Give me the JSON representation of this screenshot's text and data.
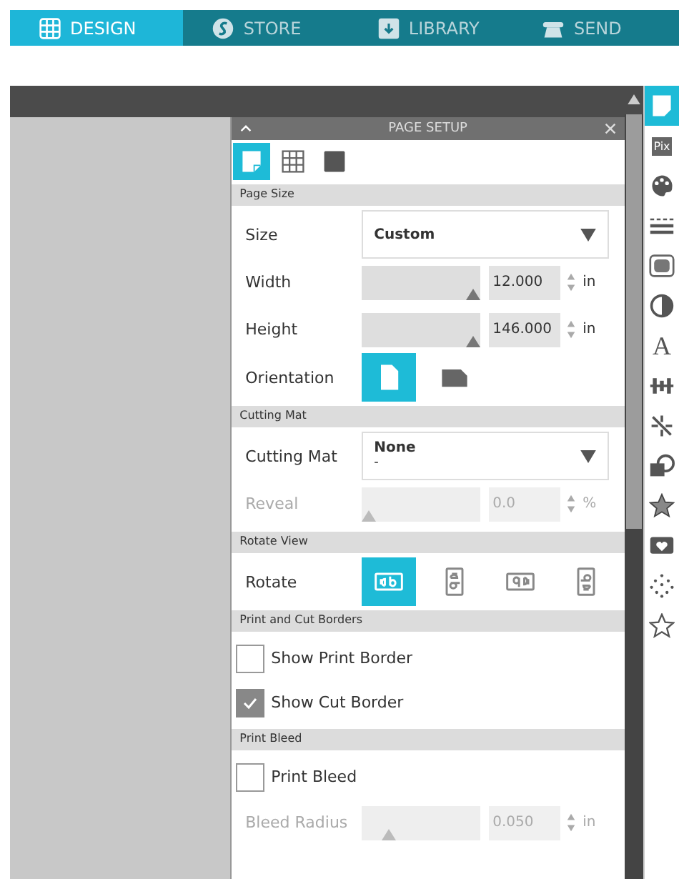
{
  "nav_tabs": [
    {
      "label": "DESIGN",
      "selected": true
    },
    {
      "label": "STORE",
      "selected": false
    },
    {
      "label": "LIBRARY",
      "selected": false
    },
    {
      "label": "SEND",
      "selected": false
    }
  ],
  "panel": {
    "title": "PAGE SETUP",
    "view_tabs": [
      {
        "selected": true
      },
      {
        "selected": false
      },
      {
        "selected": false
      }
    ],
    "sections": [
      {
        "title": "Page Size",
        "rows": [
          {
            "kind": "dropdown",
            "label": "Size",
            "value": "Custom"
          },
          {
            "kind": "slider",
            "label": "Width",
            "level": 1,
            "value": "12.000",
            "unit": "in",
            "disabled": false
          },
          {
            "kind": "slider",
            "label": "Height",
            "level": 1,
            "value": "146.000",
            "unit": "in",
            "disabled": false
          },
          {
            "kind": "buttons",
            "label": "Orientation",
            "options": [
              {
                "selected": true
              },
              {
                "selected": false
              }
            ]
          }
        ]
      },
      {
        "title": "Cutting Mat",
        "rows": [
          {
            "kind": "dropdown",
            "label": "Cutting Mat",
            "value": "None",
            "value_2": "-"
          },
          {
            "kind": "slider",
            "label": "Reveal",
            "level": 0,
            "value": "0.0",
            "unit": "%",
            "disabled": true
          }
        ]
      },
      {
        "title": "Rotate View",
        "rows": [
          {
            "kind": "buttons",
            "label": "Rotate",
            "options": [
              {
                "selected": true
              },
              {
                "selected": false
              },
              {
                "selected": false
              },
              {
                "selected": false
              }
            ]
          }
        ]
      },
      {
        "title": "Print and Cut Borders",
        "rows": [
          {
            "kind": "checkbox",
            "label": "Show Print Border",
            "checked": false
          },
          {
            "kind": "checkbox",
            "label": "Show Cut Border",
            "checked": true
          }
        ]
      },
      {
        "title": "Print Bleed",
        "rows": [
          {
            "kind": "checkbox",
            "label": "Print Bleed",
            "checked": false
          },
          {
            "kind": "slider",
            "label": "Bleed Radius",
            "level": 0.2,
            "value": "0.050",
            "unit": "in",
            "disabled": true
          }
        ]
      }
    ]
  },
  "toolbar": [
    {
      "selected": true
    },
    {
      "selected": false,
      "glyph": "Pix"
    },
    {
      "selected": false
    },
    {
      "selected": false
    },
    {
      "selected": false
    },
    {
      "selected": false
    },
    {
      "selected": false,
      "glyph": "A"
    },
    {
      "selected": false
    },
    {
      "selected": false
    },
    {
      "selected": false
    },
    {
      "selected": false
    },
    {
      "selected": false
    },
    {
      "selected": false
    },
    {
      "selected": false
    }
  ]
}
